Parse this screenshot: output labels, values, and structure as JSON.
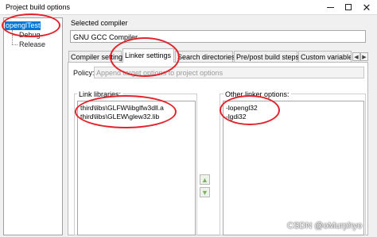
{
  "window": {
    "title": "Project build options"
  },
  "tree": {
    "root": "openglTest",
    "children": [
      "Debug",
      "Release"
    ]
  },
  "compiler": {
    "label": "Selected compiler",
    "value": "GNU GCC Compiler"
  },
  "tabs": [
    {
      "label": "Compiler settings",
      "active": false
    },
    {
      "label": "Linker settings",
      "active": true
    },
    {
      "label": "Search directories",
      "active": false
    },
    {
      "label": "Pre/post build steps",
      "active": false
    },
    {
      "label": "Custom variable",
      "active": false
    }
  ],
  "policy": {
    "label": "Policy:",
    "value": "Append target options to project options"
  },
  "link_libraries": {
    "title": "Link libraries:",
    "items": [
      "third\\libs\\GLFW\\libglfw3dll.a",
      "third\\libs\\GLEW\\glew32.lib"
    ]
  },
  "other_linker_options": {
    "title": "Other linker options:",
    "items": [
      "-lopengl32",
      "-lgdi32"
    ]
  },
  "watermark": "CSDN @oMurphyo",
  "colors": {
    "selection": "#0078d7",
    "annotation": "#e3232b"
  }
}
